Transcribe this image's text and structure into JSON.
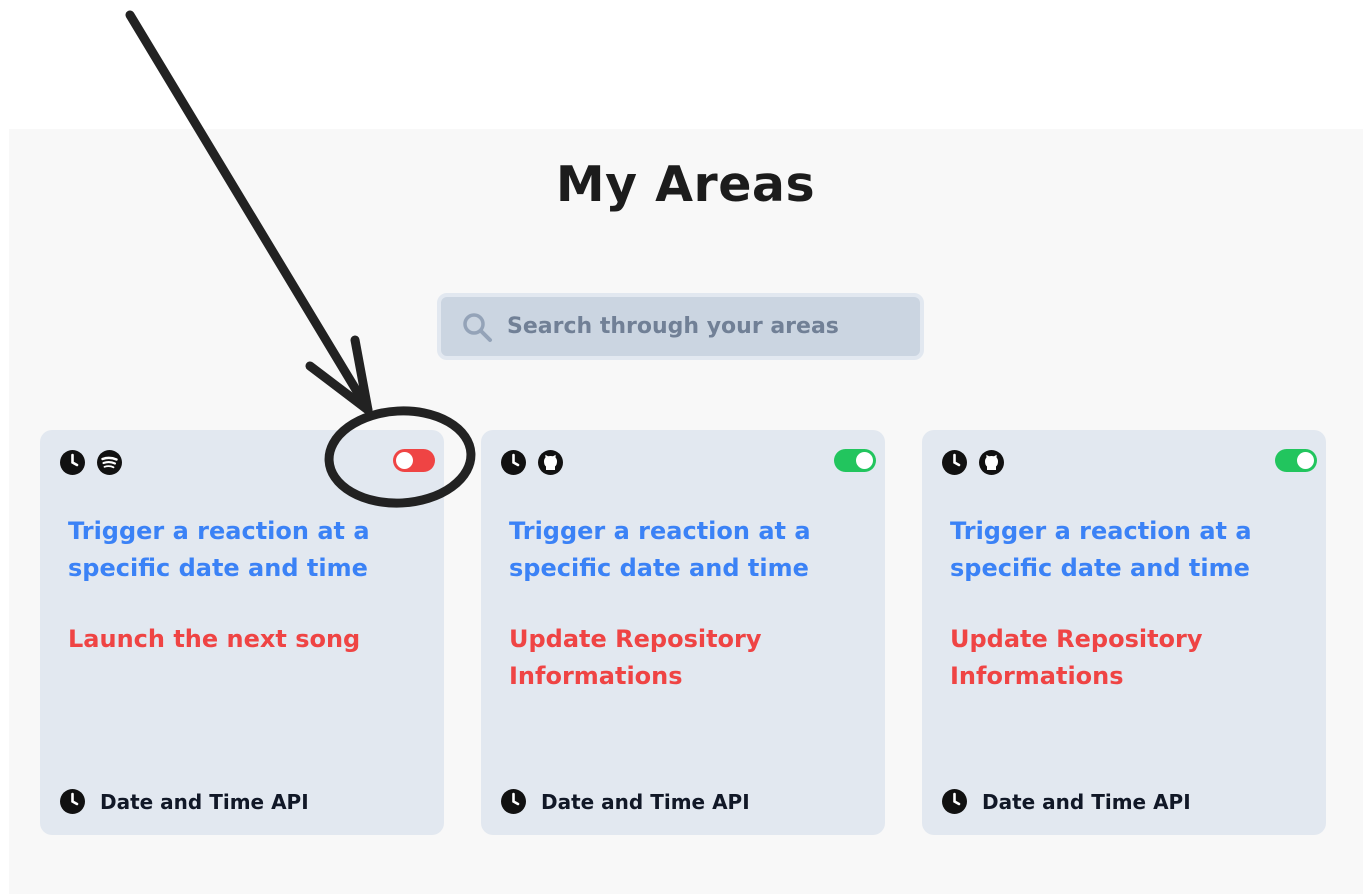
{
  "page": {
    "title": "My Areas"
  },
  "search": {
    "placeholder": "Search through your areas"
  },
  "cards": [
    {
      "action_icon": "clock-icon",
      "reaction_icon": "spotify-icon",
      "enabled": false,
      "action": "Trigger a reaction at a specific date and time",
      "reaction": "Launch the next song",
      "service": "Date and Time API"
    },
    {
      "action_icon": "clock-icon",
      "reaction_icon": "github-icon",
      "enabled": true,
      "action": "Trigger a reaction at a specific date and time",
      "reaction": "Update Repository Informations",
      "service": "Date and Time API"
    },
    {
      "action_icon": "clock-icon",
      "reaction_icon": "github-icon",
      "enabled": true,
      "action": "Trigger a reaction at a specific date and time",
      "reaction": "Update Repository Informations",
      "service": "Date and Time API"
    }
  ],
  "colors": {
    "action_text": "#3b82f6",
    "reaction_text": "#ef4444",
    "toggle_off": "#ef4444",
    "toggle_on": "#22c55e",
    "card_bg": "#e2e8f0",
    "annotation": "#222222"
  }
}
